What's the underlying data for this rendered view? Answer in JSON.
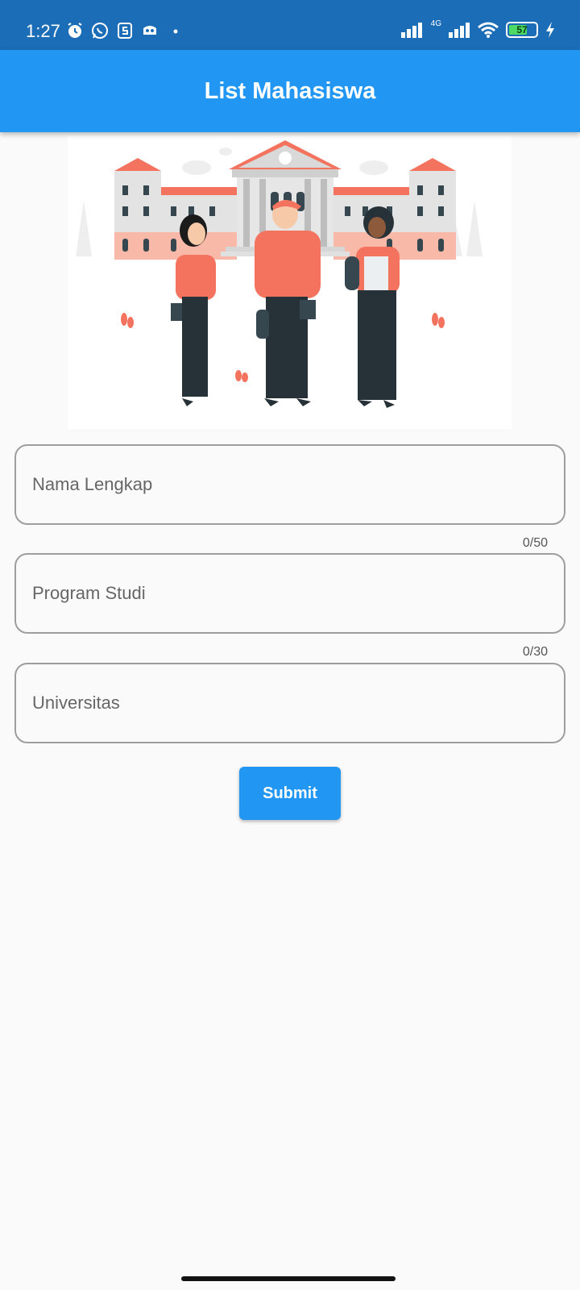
{
  "status_bar": {
    "time": "1:27",
    "network": "4G",
    "battery_level": "57",
    "icons": [
      "alarm-icon",
      "whatsapp-icon",
      "s-icon",
      "gamepad-icon",
      "dot-icon",
      "signal-icon",
      "wifi-icon",
      "battery-icon",
      "charging-icon"
    ]
  },
  "app_bar": {
    "title": "List Mahasiswa"
  },
  "form": {
    "fields": [
      {
        "placeholder": "Nama Lengkap",
        "value": "",
        "counter": "0/50"
      },
      {
        "placeholder": "Program Studi",
        "value": "",
        "counter": "0/30"
      },
      {
        "placeholder": "Universitas",
        "value": ""
      }
    ],
    "submit_label": "Submit"
  },
  "colors": {
    "status_bar": "#1c6db7",
    "app_bar": "#2196f3",
    "button": "#2196f3",
    "accent_illustration": "#f4735f",
    "background": "#fafafa"
  }
}
